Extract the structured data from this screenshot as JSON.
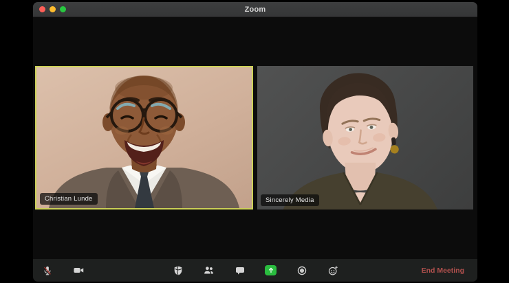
{
  "window": {
    "title": "Zoom",
    "controls": {
      "close": "close",
      "minimize": "minimize",
      "fullscreen": "zoom"
    }
  },
  "participants": [
    {
      "name": "Christian Lunde",
      "active_speaker": true
    },
    {
      "name": "Sincerely Media",
      "active_speaker": false
    }
  ],
  "toolbar": {
    "left_icons": [
      "microphone-muted",
      "video-camera"
    ],
    "center_icons": [
      "security-shield",
      "participants",
      "chat",
      "share-screen",
      "record",
      "reactions"
    ],
    "end_meeting_label": "End Meeting"
  },
  "colors": {
    "active_speaker_border": "#ccd157",
    "share_screen_green": "#2abd3f",
    "end_meeting_red": "#b0504d",
    "mic_muted_red": "#b33a34",
    "traffic_red": "#ff5f57",
    "traffic_yellow": "#febc2e",
    "traffic_green": "#28c840",
    "toolbar_bg": "#1e201f"
  }
}
